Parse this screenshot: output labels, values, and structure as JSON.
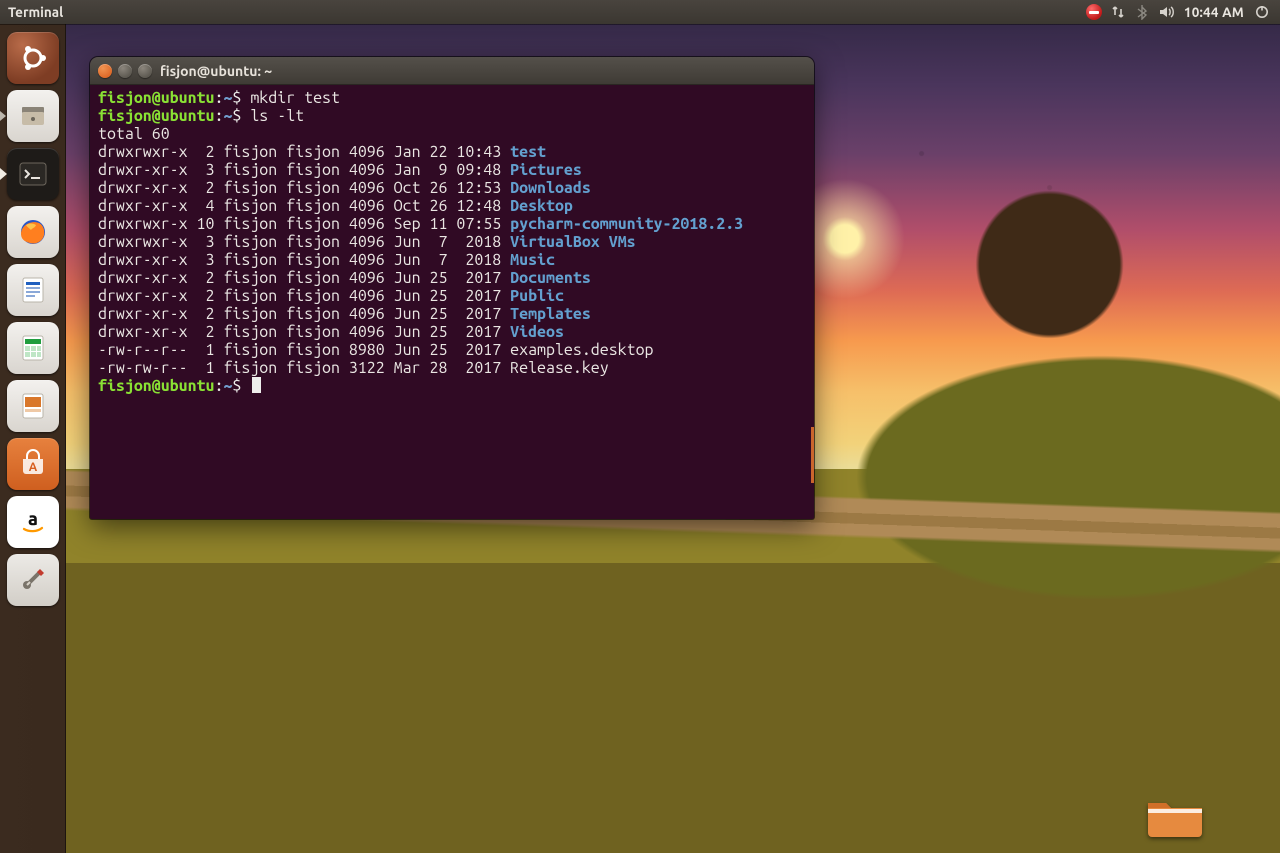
{
  "panel": {
    "app_title": "Terminal",
    "clock": "10:44 AM"
  },
  "launcher": {
    "items": [
      {
        "name": "dash",
        "tooltip": "Dash"
      },
      {
        "name": "files",
        "tooltip": "Files"
      },
      {
        "name": "terminal",
        "tooltip": "Terminal",
        "active": true
      },
      {
        "name": "firefox",
        "tooltip": "Firefox"
      },
      {
        "name": "writer",
        "tooltip": "LibreOffice Writer"
      },
      {
        "name": "calc",
        "tooltip": "LibreOffice Calc"
      },
      {
        "name": "impress",
        "tooltip": "LibreOffice Impress"
      },
      {
        "name": "software",
        "tooltip": "Ubuntu Software"
      },
      {
        "name": "amazon",
        "tooltip": "Amazon"
      },
      {
        "name": "settings",
        "tooltip": "System Settings"
      }
    ]
  },
  "terminal": {
    "title": "fisjon@ubuntu: ~",
    "prompt": {
      "user_host": "fisjon@ubuntu",
      "sep": ":",
      "path": "~",
      "symbol": "$"
    },
    "history": [
      {
        "cmd": "mkdir test"
      },
      {
        "cmd": "ls -lt"
      }
    ],
    "output": {
      "total_line": "total 60",
      "rows": [
        {
          "perm": "drwxrwxr-x",
          "links": " 2",
          "owner": "fisjon",
          "group": "fisjon",
          "size": "4096",
          "date": "Jan 22 10:43",
          "name": "test",
          "is_dir": true
        },
        {
          "perm": "drwxr-xr-x",
          "links": " 3",
          "owner": "fisjon",
          "group": "fisjon",
          "size": "4096",
          "date": "Jan  9 09:48",
          "name": "Pictures",
          "is_dir": true
        },
        {
          "perm": "drwxr-xr-x",
          "links": " 2",
          "owner": "fisjon",
          "group": "fisjon",
          "size": "4096",
          "date": "Oct 26 12:53",
          "name": "Downloads",
          "is_dir": true
        },
        {
          "perm": "drwxr-xr-x",
          "links": " 4",
          "owner": "fisjon",
          "group": "fisjon",
          "size": "4096",
          "date": "Oct 26 12:48",
          "name": "Desktop",
          "is_dir": true
        },
        {
          "perm": "drwxrwxr-x",
          "links": "10",
          "owner": "fisjon",
          "group": "fisjon",
          "size": "4096",
          "date": "Sep 11 07:55",
          "name": "pycharm-community-2018.2.3",
          "is_dir": true
        },
        {
          "perm": "drwxrwxr-x",
          "links": " 3",
          "owner": "fisjon",
          "group": "fisjon",
          "size": "4096",
          "date": "Jun  7  2018",
          "name": "VirtualBox VMs",
          "is_dir": true
        },
        {
          "perm": "drwxr-xr-x",
          "links": " 3",
          "owner": "fisjon",
          "group": "fisjon",
          "size": "4096",
          "date": "Jun  7  2018",
          "name": "Music",
          "is_dir": true
        },
        {
          "perm": "drwxr-xr-x",
          "links": " 2",
          "owner": "fisjon",
          "group": "fisjon",
          "size": "4096",
          "date": "Jun 25  2017",
          "name": "Documents",
          "is_dir": true
        },
        {
          "perm": "drwxr-xr-x",
          "links": " 2",
          "owner": "fisjon",
          "group": "fisjon",
          "size": "4096",
          "date": "Jun 25  2017",
          "name": "Public",
          "is_dir": true
        },
        {
          "perm": "drwxr-xr-x",
          "links": " 2",
          "owner": "fisjon",
          "group": "fisjon",
          "size": "4096",
          "date": "Jun 25  2017",
          "name": "Templates",
          "is_dir": true
        },
        {
          "perm": "drwxr-xr-x",
          "links": " 2",
          "owner": "fisjon",
          "group": "fisjon",
          "size": "4096",
          "date": "Jun 25  2017",
          "name": "Videos",
          "is_dir": true
        },
        {
          "perm": "-rw-r--r--",
          "links": " 1",
          "owner": "fisjon",
          "group": "fisjon",
          "size": "8980",
          "date": "Jun 25  2017",
          "name": "examples.desktop",
          "is_dir": false
        },
        {
          "perm": "-rw-rw-r--",
          "links": " 1",
          "owner": "fisjon",
          "group": "fisjon",
          "size": "3122",
          "date": "Mar 28  2017",
          "name": "Release.key",
          "is_dir": false
        }
      ]
    }
  }
}
